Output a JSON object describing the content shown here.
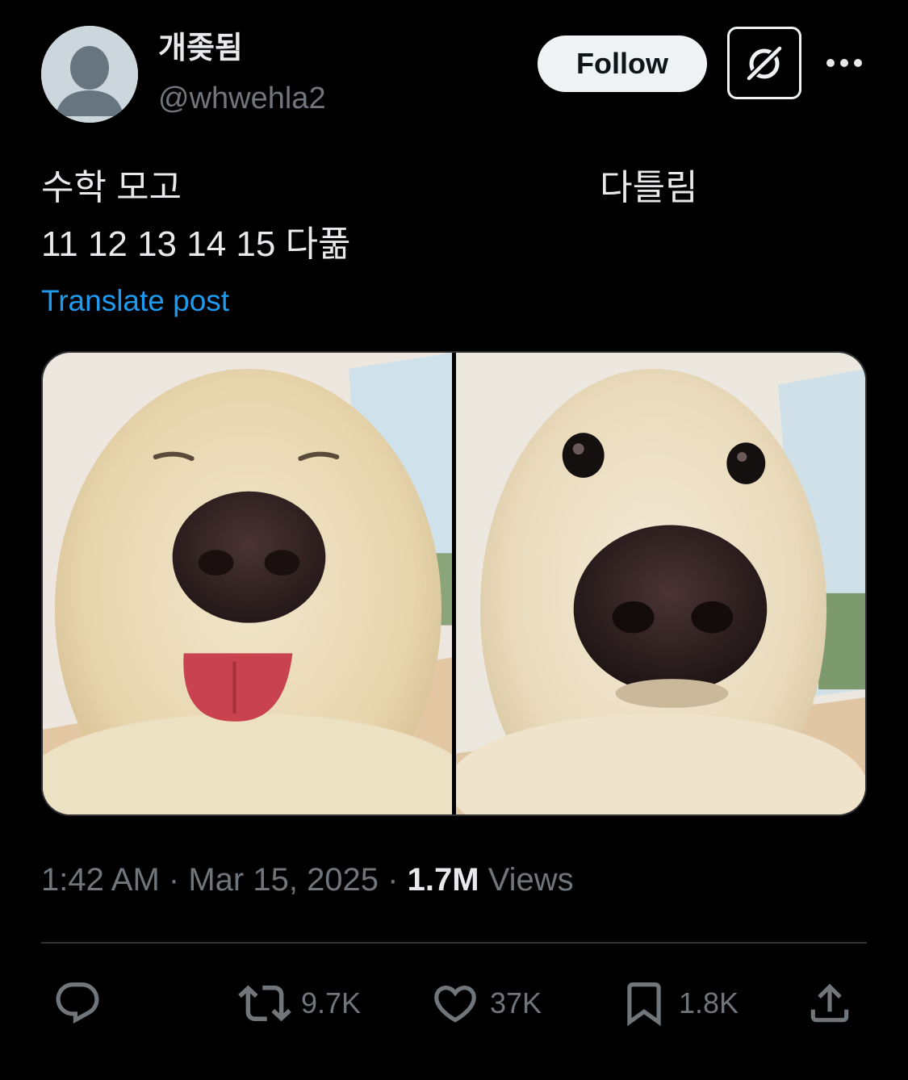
{
  "author": {
    "display_name": "개좆됨",
    "handle": "@whwehla2"
  },
  "header": {
    "follow_label": "Follow"
  },
  "post": {
    "line1_left": "수학 모고",
    "line1_right": "다틀림",
    "line2": "11 12 13 14 15 다풂",
    "translate_label": "Translate post"
  },
  "meta": {
    "time": "1:42 AM",
    "separator": "·",
    "date": "Mar 15, 2025",
    "views_count": "1.7M",
    "views_label": "Views"
  },
  "actions": {
    "reposts": "9.7K",
    "likes": "37K",
    "bookmarks": "1.8K"
  },
  "icons": {
    "avatar": "default-avatar-icon",
    "grok": "grok-icon",
    "more": "more-dots-icon",
    "reply": "reply-icon",
    "repost": "repost-icon",
    "like": "heart-icon",
    "bookmark": "bookmark-icon",
    "share": "share-icon"
  },
  "colors": {
    "background": "#000000",
    "text_primary": "#e7e9ea",
    "text_secondary": "#71767b",
    "link": "#1d9bf0",
    "divider": "#2f3336",
    "follow_bg": "#eff3f4"
  }
}
